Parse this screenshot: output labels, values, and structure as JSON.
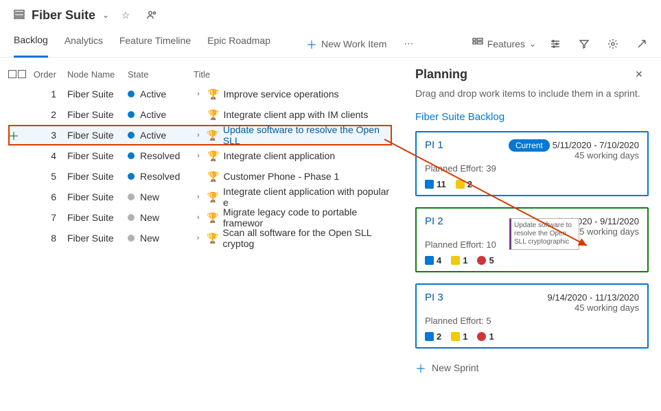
{
  "header": {
    "title": "Fiber Suite"
  },
  "tabs": {
    "items": [
      "Backlog",
      "Analytics",
      "Feature Timeline",
      "Epic Roadmap"
    ],
    "new_item": "New Work Item",
    "features": "Features"
  },
  "columns": {
    "order": "Order",
    "node": "Node Name",
    "state": "State",
    "title": "Title"
  },
  "rows": [
    {
      "order": "1",
      "node": "Fiber Suite",
      "state": "Active",
      "state_cls": "st-active",
      "title": "Improve service operations",
      "link": false,
      "exp": true
    },
    {
      "order": "2",
      "node": "Fiber Suite",
      "state": "Active",
      "state_cls": "st-active",
      "title": "Integrate client app with IM clients",
      "link": false,
      "exp": false
    },
    {
      "order": "3",
      "node": "Fiber Suite",
      "state": "Active",
      "state_cls": "st-active",
      "title": "Update software to resolve the Open SLL",
      "link": true,
      "exp": true,
      "selected": true
    },
    {
      "order": "4",
      "node": "Fiber Suite",
      "state": "Resolved",
      "state_cls": "st-resolved",
      "title": "Integrate client application",
      "link": false,
      "exp": true
    },
    {
      "order": "5",
      "node": "Fiber Suite",
      "state": "Resolved",
      "state_cls": "st-resolved",
      "title": "Customer Phone - Phase 1",
      "link": false,
      "exp": false
    },
    {
      "order": "6",
      "node": "Fiber Suite",
      "state": "New",
      "state_cls": "st-new",
      "title": "Integrate client application with popular e",
      "link": false,
      "exp": true
    },
    {
      "order": "7",
      "node": "Fiber Suite",
      "state": "New",
      "state_cls": "st-new",
      "title": "Migrate legacy code to portable framewor",
      "link": false,
      "exp": true
    },
    {
      "order": "8",
      "node": "Fiber Suite",
      "state": "New",
      "state_cls": "st-new",
      "title": "Scan all software for the Open SLL cryptog",
      "link": false,
      "exp": true
    }
  ],
  "panel": {
    "title": "Planning",
    "subtitle": "Drag and drop work items to include them in a sprint.",
    "backlog": "Fiber Suite Backlog",
    "new_sprint": "New Sprint",
    "current": "Current",
    "ghost": "Update software to resolve the Open SLL cryptographic"
  },
  "sprints": [
    {
      "name": "PI 1",
      "dates": "5/11/2020 - 7/10/2020",
      "days": "45 working days",
      "effort": "Planned Effort: 39",
      "n1": "11",
      "n2": "2",
      "n3": "",
      "current": true,
      "cls": ""
    },
    {
      "name": "PI 2",
      "dates": "7/13/2020 - 9/11/2020",
      "days": "45 working days",
      "effort": "Planned Effort: 10",
      "n1": "4",
      "n2": "1",
      "n3": "5",
      "current": false,
      "cls": "s2",
      "ghost": true
    },
    {
      "name": "PI 3",
      "dates": "9/14/2020 - 11/13/2020",
      "days": "45 working days",
      "effort": "Planned Effort: 5",
      "n1": "2",
      "n2": "1",
      "n3": "1",
      "current": false,
      "cls": ""
    }
  ]
}
